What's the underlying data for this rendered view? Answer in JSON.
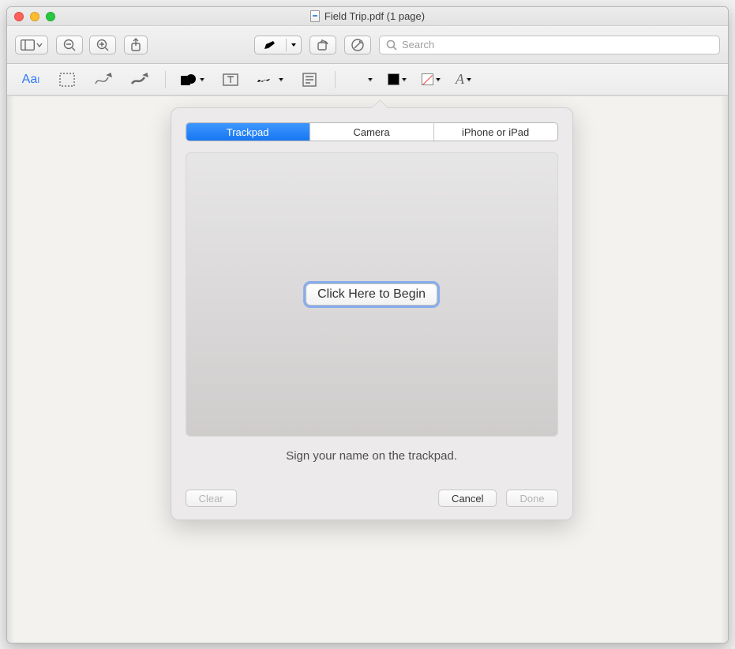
{
  "window": {
    "title": "Field Trip.pdf (1 page)"
  },
  "toolbar": {
    "search_placeholder": "Search"
  },
  "signature_popover": {
    "tabs": {
      "trackpad": "Trackpad",
      "camera": "Camera",
      "iphone_ipad": "iPhone or iPad"
    },
    "begin_button": "Click Here to Begin",
    "instruction": "Sign your name on the trackpad.",
    "buttons": {
      "clear": "Clear",
      "cancel": "Cancel",
      "done": "Done"
    }
  }
}
